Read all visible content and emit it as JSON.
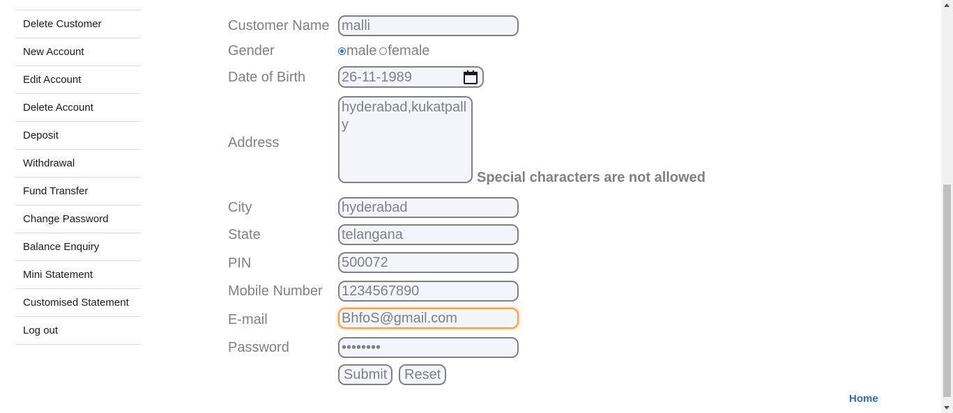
{
  "sidebar": {
    "items": [
      {
        "label": "Edit Customer"
      },
      {
        "label": "Delete Customer"
      },
      {
        "label": "New Account"
      },
      {
        "label": "Edit Account"
      },
      {
        "label": "Delete Account"
      },
      {
        "label": "Deposit"
      },
      {
        "label": "Withdrawal"
      },
      {
        "label": "Fund Transfer"
      },
      {
        "label": "Change Password"
      },
      {
        "label": "Balance Enquiry"
      },
      {
        "label": "Mini Statement"
      },
      {
        "label": "Customised Statement"
      },
      {
        "label": "Log out"
      }
    ]
  },
  "form": {
    "labels": {
      "customer_name": "Customer Name",
      "gender": "Gender",
      "dob": "Date of Birth",
      "address": "Address",
      "city": "City",
      "state": "State",
      "pin": "PIN",
      "mobile": "Mobile Number",
      "email": "E-mail",
      "password": "Password"
    },
    "values": {
      "customer_name": "malli",
      "dob": "26-11-1989",
      "address": "hyderabad,kukatpally",
      "city": "hyderabad",
      "state": "telangana",
      "pin": "500072",
      "mobile": "1234567890",
      "email": "BhfoS@gmail.com",
      "password": "••••••••"
    },
    "gender_options": [
      "male",
      "female"
    ],
    "gender_selected": "male",
    "address_error": "Special characters are not allowed",
    "submit_label": "Submit",
    "reset_label": "Reset"
  },
  "footer": {
    "home_link": "Home"
  },
  "colors": {
    "focus_border": "#f5a342",
    "link": "#2a6fb0",
    "radio_checked": "#1a73e8"
  }
}
